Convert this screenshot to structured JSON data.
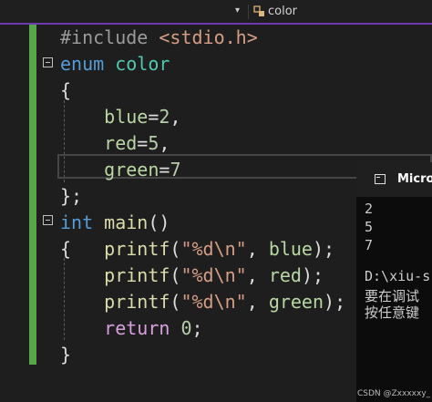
{
  "topbar": {
    "dropdown_glyph": "▾",
    "class_label": "color",
    "class_icon": "class-icon"
  },
  "code": {
    "l1": {
      "directive": "#include",
      "header": "<stdio.h>"
    },
    "l2": {
      "kw": "enum",
      "name": "color"
    },
    "l3": "{",
    "l4": {
      "name": "blue",
      "eq": "=",
      "num": "2",
      "tail": ","
    },
    "l5": {
      "name": "red",
      "eq": "=",
      "num": "5",
      "tail": ","
    },
    "l6": {
      "name": "green",
      "eq": "=",
      "num": "7"
    },
    "l7": "};",
    "l8": {
      "kw": "int",
      "fn": "main",
      "tail": "()"
    },
    "l9": {
      "brace": "{",
      "fn": "printf",
      "open": "(",
      "str": "\"%d\\n\"",
      "sep": ", ",
      "arg": "blue",
      "close": ");"
    },
    "l10": {
      "fn": "printf",
      "open": "(",
      "str": "\"%d\\n\"",
      "sep": ", ",
      "arg": "red",
      "close": ");"
    },
    "l11": {
      "fn": "printf",
      "open": "(",
      "str": "\"%d\\n\"",
      "sep": ", ",
      "arg": "green",
      "close": ");"
    },
    "l12": {
      "kw": "return",
      "num": "0",
      "tail": ";"
    },
    "l13": "}"
  },
  "console": {
    "title": "Micros",
    "lines": [
      "2",
      "5",
      "7",
      "",
      "D:\\xiu-s",
      "要在调试",
      "按任意键"
    ]
  },
  "watermark": "CSDN @Zxxxxxy_"
}
